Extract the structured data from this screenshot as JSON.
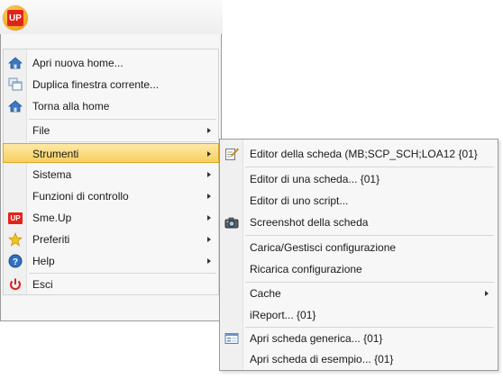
{
  "app": {
    "logo_text": "UP",
    "brand_color": "#e2231a",
    "logo_bg": "#f4a41c"
  },
  "menu": {
    "items": [
      {
        "label": "Apri nuova home...",
        "icon": "home-icon"
      },
      {
        "label": "Duplica finestra corrente...",
        "icon": "windows-icon"
      },
      {
        "label": "Torna alla home",
        "icon": "home-icon"
      },
      {
        "label": "File",
        "submenu": true
      },
      {
        "label": "Strumenti",
        "submenu": true,
        "active": true
      },
      {
        "label": "Sistema",
        "submenu": true
      },
      {
        "label": "Funzioni di controllo",
        "submenu": true
      },
      {
        "label": "Sme.Up",
        "submenu": true,
        "icon": "smeup-logo-icon"
      },
      {
        "label": "Preferiti",
        "submenu": true,
        "icon": "star-icon"
      },
      {
        "label": "Help",
        "submenu": true,
        "icon": "help-icon"
      },
      {
        "label": "Esci",
        "icon": "power-icon"
      }
    ]
  },
  "submenu": {
    "items": [
      {
        "label": "Editor della scheda (MB;SCP_SCH;LOA12 {01}",
        "icon": "edit-icon"
      },
      {
        "label": "Editor di una scheda... {01}"
      },
      {
        "label": "Editor di uno script..."
      },
      {
        "label": "Screenshot della scheda",
        "icon": "camera-icon"
      },
      {
        "label": "Carica/Gestisci configurazione"
      },
      {
        "label": "Ricarica configurazione"
      },
      {
        "label": "Cache",
        "submenu": true
      },
      {
        "label": "iReport... {01}"
      },
      {
        "label": "Apri scheda generica... {01}",
        "icon": "form-icon"
      },
      {
        "label": "Apri scheda di esempio... {01}"
      }
    ]
  }
}
